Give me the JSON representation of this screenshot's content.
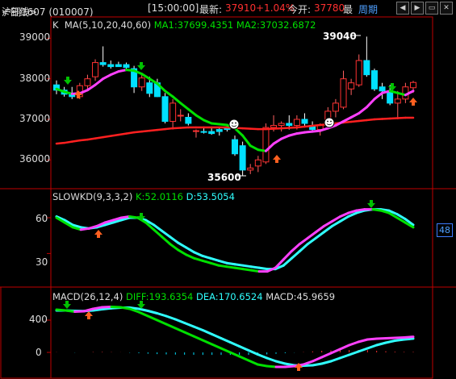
{
  "header": {
    "title": "沪铜1607 (010007)",
    "period_sel": "<日线>",
    "time": "[15:00:00]",
    "latest_label": "最新:",
    "latest_value": "37910",
    "change": "+1.04%",
    "open_label": "今开:",
    "open_value": "37780",
    "cut": "最",
    "period_link": "周期"
  },
  "main_panel": {
    "k_label": "K",
    "ma_title": "MA(5,10,20,40,60)",
    "ma1": "MA1:37699.4351",
    "ma2": "MA2:37032.6872",
    "y_ticks": [
      "39000",
      "38000",
      "37000",
      "36000"
    ],
    "high_anno": "39040",
    "low_anno": "35600"
  },
  "kd_panel": {
    "title": "SLOWKD(9,3,3,2)",
    "k": "K:52.0116",
    "d": "D:53.5054",
    "y_ticks": [
      "60",
      "30"
    ],
    "tag": "48"
  },
  "macd_panel": {
    "title": "MACD(26,12,4)",
    "diff": "DIFF:193.6354",
    "dea": "DEA:170.6524",
    "macd": "MACD:45.9659",
    "y_ticks": [
      "400",
      "0"
    ]
  },
  "colors": {
    "up": "#ff3030",
    "down": "#00e0ff",
    "ma_green": "#00e000",
    "ma_pink": "#ff40ff",
    "ma_red": "#ff2020",
    "kd_cyan": "#30ffff",
    "border": "#c00000"
  },
  "chart_data": {
    "type": "candlestick",
    "candles": [
      {
        "o": 37850,
        "h": 37960,
        "l": 37620,
        "c": 37720
      },
      {
        "o": 37720,
        "h": 37800,
        "l": 37560,
        "c": 37620
      },
      {
        "o": 37620,
        "h": 37800,
        "l": 37500,
        "c": 37560
      },
      {
        "o": 37560,
        "h": 37900,
        "l": 37500,
        "c": 37830
      },
      {
        "o": 37830,
        "h": 38100,
        "l": 37750,
        "c": 38000
      },
      {
        "o": 38050,
        "h": 38480,
        "l": 37950,
        "c": 38400
      },
      {
        "o": 38400,
        "h": 38800,
        "l": 38300,
        "c": 38350
      },
      {
        "o": 38350,
        "h": 38450,
        "l": 38250,
        "c": 38300
      },
      {
        "o": 38350,
        "h": 38420,
        "l": 38300,
        "c": 38300
      },
      {
        "o": 38350,
        "h": 38400,
        "l": 38250,
        "c": 38280
      },
      {
        "o": 38250,
        "h": 38320,
        "l": 37650,
        "c": 37800
      },
      {
        "o": 37800,
        "h": 38150,
        "l": 37700,
        "c": 38020
      },
      {
        "o": 37900,
        "h": 38050,
        "l": 37550,
        "c": 37640
      },
      {
        "o": 37900,
        "h": 38000,
        "l": 37550,
        "c": 37560
      },
      {
        "o": 37560,
        "h": 37650,
        "l": 36900,
        "c": 36950
      },
      {
        "o": 36950,
        "h": 37500,
        "l": 36750,
        "c": 37400
      },
      {
        "o": 37100,
        "h": 37250,
        "l": 36950,
        "c": 37100
      },
      {
        "o": 37050,
        "h": 37150,
        "l": 36850,
        "c": 36900
      },
      {
        "o": 36700,
        "h": 36750,
        "l": 36550,
        "c": 36720
      },
      {
        "o": 36700,
        "h": 36800,
        "l": 36650,
        "c": 36680
      },
      {
        "o": 36700,
        "h": 36800,
        "l": 36620,
        "c": 36650
      },
      {
        "o": 36750,
        "h": 36820,
        "l": 36600,
        "c": 36700
      },
      {
        "o": 36800,
        "h": 36850,
        "l": 36700,
        "c": 36750
      },
      {
        "o": 36500,
        "h": 36600,
        "l": 36100,
        "c": 36150
      },
      {
        "o": 36350,
        "h": 36450,
        "l": 35600,
        "c": 35750
      },
      {
        "o": 35750,
        "h": 35900,
        "l": 35650,
        "c": 35800
      },
      {
        "o": 35850,
        "h": 36100,
        "l": 35700,
        "c": 36000
      },
      {
        "o": 35950,
        "h": 36900,
        "l": 35900,
        "c": 36800
      },
      {
        "o": 36800,
        "h": 37100,
        "l": 36700,
        "c": 36850
      },
      {
        "o": 36850,
        "h": 36950,
        "l": 36700,
        "c": 36900
      },
      {
        "o": 36900,
        "h": 37100,
        "l": 36750,
        "c": 36850
      },
      {
        "o": 36850,
        "h": 37100,
        "l": 36750,
        "c": 37000
      },
      {
        "o": 37000,
        "h": 37150,
        "l": 36800,
        "c": 36900
      },
      {
        "o": 36850,
        "h": 36950,
        "l": 36700,
        "c": 36750
      },
      {
        "o": 36750,
        "h": 36900,
        "l": 36600,
        "c": 36850
      },
      {
        "o": 36850,
        "h": 37300,
        "l": 36800,
        "c": 37200
      },
      {
        "o": 37200,
        "h": 37500,
        "l": 37050,
        "c": 37400
      },
      {
        "o": 37300,
        "h": 38200,
        "l": 37250,
        "c": 38000
      },
      {
        "o": 37750,
        "h": 38000,
        "l": 37600,
        "c": 37900
      },
      {
        "o": 37850,
        "h": 38600,
        "l": 37800,
        "c": 38450
      },
      {
        "o": 38450,
        "h": 39040,
        "l": 38050,
        "c": 38100
      },
      {
        "o": 38200,
        "h": 38250,
        "l": 37700,
        "c": 37750
      },
      {
        "o": 37800,
        "h": 37900,
        "l": 37500,
        "c": 37700
      },
      {
        "o": 37700,
        "h": 37850,
        "l": 37350,
        "c": 37400
      },
      {
        "o": 37400,
        "h": 37700,
        "l": 37000,
        "c": 37500
      },
      {
        "o": 37500,
        "h": 37900,
        "l": 37400,
        "c": 37800
      },
      {
        "o": 37780,
        "h": 37950,
        "l": 37650,
        "c": 37910
      }
    ],
    "ma_short": [
      37750,
      37680,
      37630,
      37640,
      37720,
      37850,
      38000,
      38100,
      38180,
      38220,
      38200,
      38120,
      38000,
      37880,
      37700,
      37560,
      37400,
      37250,
      37100,
      36980,
      36900,
      36880,
      36860,
      36780,
      36600,
      36350,
      36250,
      36220,
      36400,
      36520,
      36600,
      36650,
      36680,
      36700,
      36720,
      36780,
      36850,
      36950,
      37050,
      37150,
      37300,
      37500,
      37650,
      37700,
      37650,
      37600,
      37700
    ],
    "ma_long": [
      36400,
      36420,
      36450,
      36480,
      36500,
      36530,
      36560,
      36590,
      36620,
      36650,
      36680,
      36700,
      36720,
      36740,
      36760,
      36780,
      36790,
      36800,
      36800,
      36800,
      36800,
      36800,
      36800,
      36790,
      36780,
      36770,
      36760,
      36760,
      36770,
      36780,
      36790,
      36800,
      36820,
      36840,
      36860,
      36880,
      36900,
      36920,
      36940,
      36960,
      36980,
      37000,
      37010,
      37020,
      37030,
      37040,
      37040
    ],
    "kd_k": [
      60,
      56,
      52,
      50,
      51,
      53,
      56,
      58,
      60,
      61,
      60,
      56,
      50,
      44,
      38,
      33,
      29,
      26,
      24,
      22,
      20,
      19,
      18,
      17,
      16,
      15,
      15,
      18,
      25,
      32,
      38,
      43,
      48,
      53,
      57,
      61,
      64,
      66,
      67,
      67,
      66,
      64,
      60,
      56,
      52
    ],
    "kd_d": [
      61,
      58,
      54,
      52,
      51,
      52,
      54,
      56,
      58,
      60,
      60,
      58,
      54,
      49,
      44,
      39,
      35,
      31,
      28,
      26,
      24,
      22,
      21,
      20,
      19,
      18,
      17,
      17,
      20,
      26,
      32,
      38,
      43,
      48,
      53,
      57,
      61,
      64,
      66,
      67,
      67,
      66,
      63,
      59,
      54
    ],
    "macd_diff": [
      530,
      520,
      505,
      510,
      540,
      560,
      565,
      560,
      540,
      500,
      450,
      400,
      350,
      300,
      250,
      200,
      150,
      100,
      50,
      0,
      -50,
      -100,
      -150,
      -170,
      -180,
      -180,
      -170,
      -150,
      -110,
      -60,
      -10,
      40,
      90,
      130,
      160,
      170,
      175,
      180,
      185,
      194
    ],
    "macd_dea": [
      520,
      520,
      515,
      512,
      520,
      535,
      548,
      555,
      555,
      540,
      515,
      485,
      450,
      410,
      365,
      320,
      275,
      225,
      175,
      125,
      75,
      25,
      -25,
      -70,
      -110,
      -140,
      -160,
      -165,
      -160,
      -140,
      -110,
      -70,
      -30,
      10,
      50,
      90,
      120,
      145,
      160,
      171
    ],
    "macd_hist": [
      10,
      0,
      -10,
      -2,
      20,
      25,
      17,
      5,
      -15,
      -40,
      -65,
      -85,
      -100,
      -110,
      -115,
      -120,
      -125,
      -125,
      -125,
      -125,
      -125,
      -125,
      -125,
      -100,
      -70,
      -40,
      -10,
      15,
      50,
      80,
      100,
      110,
      120,
      120,
      110,
      80,
      55,
      35,
      25,
      23
    ]
  }
}
